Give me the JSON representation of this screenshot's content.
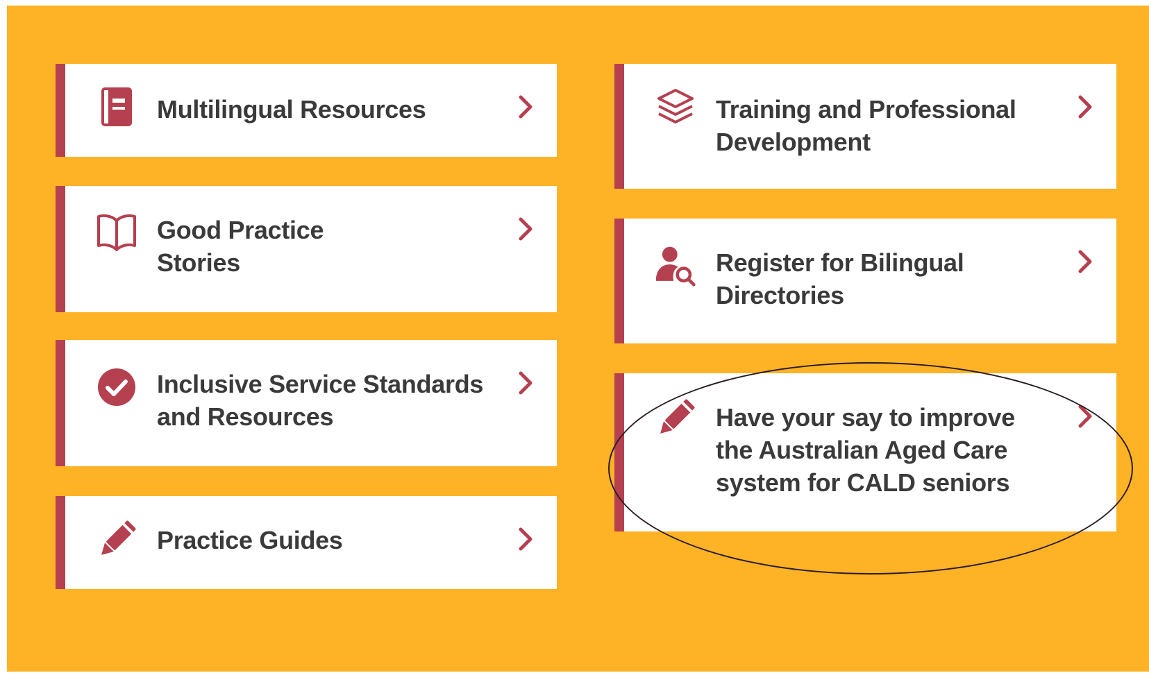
{
  "colors": {
    "background": "#FDB325",
    "accent": "#B5404F",
    "card": "#FFFFFF",
    "text": "#3A3A3A"
  },
  "cards": [
    {
      "label_lines": [
        "Multilingual Resources"
      ],
      "icon": "phrasebook-icon"
    },
    {
      "label_lines": [
        "Good Practice",
        "Stories"
      ],
      "icon": "open-book-icon"
    },
    {
      "label_lines": [
        "Inclusive Service Standards",
        "and Resources"
      ],
      "icon": "check-circle-icon"
    },
    {
      "label_lines": [
        "Practice Guides"
      ],
      "icon": "pencil-icon"
    },
    {
      "label_lines": [
        "Training and Professional",
        "Development"
      ],
      "icon": "layers-icon"
    },
    {
      "label_lines": [
        "Register for Bilingual",
        "Directories"
      ],
      "icon": "user-search-icon"
    },
    {
      "label_lines": [
        "Have your say to improve",
        "the Australian Aged Care",
        "system for CALD seniors"
      ],
      "icon": "pencil-icon"
    }
  ],
  "highlight": {
    "target": "have-your-say-card",
    "shape": "hand-drawn ellipse"
  },
  "chevron_icon": "chevron-right-icon"
}
